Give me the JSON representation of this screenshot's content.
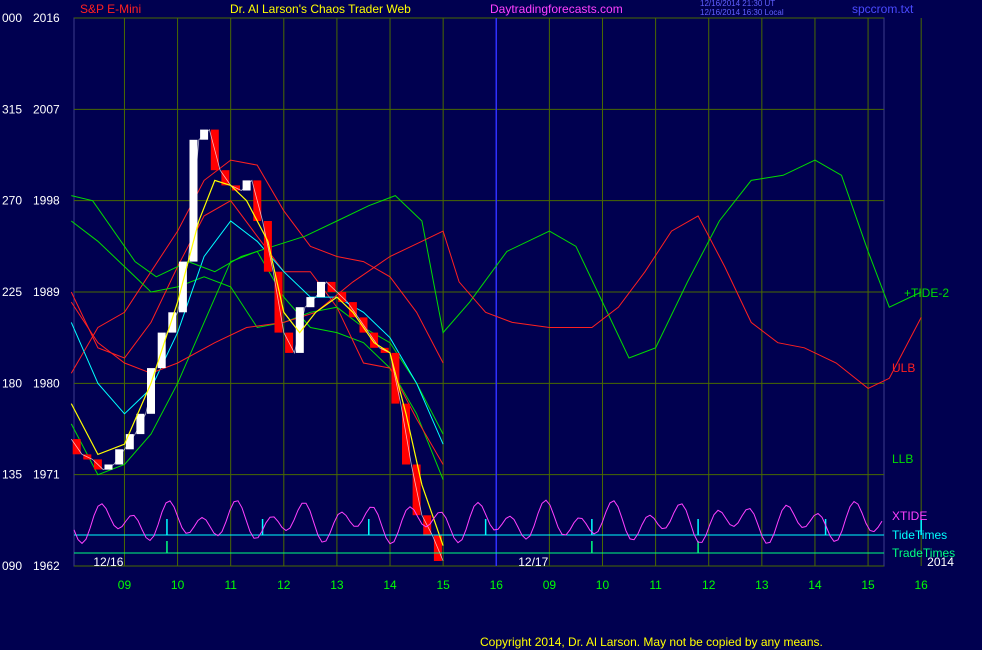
{
  "header": {
    "left_title": "S&P E-Mini",
    "center_title": "Dr. Al Larson's Chaos Trader Web",
    "site": "Daytradingforecasts.com",
    "timestamp_1": "12/16/2014 21:30 UT",
    "timestamp_2": "12/16/2014 16:30 Local",
    "file": "spccrom.txt"
  },
  "footer": {
    "copyright": "Copyright 2014, Dr. Al Larson. May not be copied by any means."
  },
  "colors": {
    "background": "#000050",
    "grid": "#4a6a00",
    "price_up": "#ffffff",
    "price_down": "#ff0000",
    "ema_fast": "#ffff00",
    "ema_mid": "#00ffff",
    "band_upper": "#ff2020",
    "band_lower": "#00dd00",
    "tide": "#00dd00",
    "ulb": "#ff2020",
    "xtide": "#ff40ff",
    "tide_times": "#00ffff",
    "trade_times": "#00ff80",
    "left_axis": "#ffffff",
    "price_axis": "#ffffff",
    "time_axis": "#00ff00"
  },
  "chart_data": {
    "type": "line",
    "price_axis": {
      "ticks": [
        "2016",
        "2007",
        "1998",
        "1989",
        "1980",
        "1971",
        "1962"
      ]
    },
    "left_axis": {
      "ticks": [
        "000",
        "315",
        "270",
        "225",
        "180",
        "135",
        "090"
      ]
    },
    "x_ticks": [
      "09",
      "10",
      "11",
      "12",
      "13",
      "14",
      "15",
      "16",
      "09",
      "10",
      "11",
      "12",
      "13",
      "14",
      "15",
      "16"
    ],
    "dates": [
      {
        "label": "12/16",
        "position": 0
      },
      {
        "label": "12/17",
        "position": 8
      },
      {
        "label": "2014",
        "position": 16
      }
    ],
    "right_labels": [
      {
        "text": "+TIDE-2",
        "color": "#00dd00"
      },
      {
        "text": "ULB",
        "color": "#ff2020"
      },
      {
        "text": "LLB",
        "color": "#00dd00"
      },
      {
        "text": "XTIDE",
        "color": "#ff40ff"
      },
      {
        "text": "TideTimes",
        "color": "#00ffff"
      },
      {
        "text": "TradeTimes",
        "color": "#00ff80"
      }
    ],
    "price_series": [
      [
        0.0,
        1974.5
      ],
      [
        0.2,
        1973.0
      ],
      [
        0.4,
        1972.5
      ],
      [
        0.6,
        1971.5
      ],
      [
        0.8,
        1972.0
      ],
      [
        1.0,
        1973.5
      ],
      [
        1.2,
        1975.0
      ],
      [
        1.4,
        1977.0
      ],
      [
        1.6,
        1981.5
      ],
      [
        1.8,
        1985.0
      ],
      [
        2.0,
        1987.0
      ],
      [
        2.2,
        1992.0
      ],
      [
        2.4,
        2004.0
      ],
      [
        2.6,
        2005.0
      ],
      [
        2.8,
        2001.0
      ],
      [
        3.0,
        1999.5
      ],
      [
        3.2,
        1999.0
      ],
      [
        3.4,
        2000.0
      ],
      [
        3.6,
        1996.0
      ],
      [
        3.8,
        1991.0
      ],
      [
        4.0,
        1985.0
      ],
      [
        4.2,
        1983.0
      ],
      [
        4.4,
        1987.5
      ],
      [
        4.6,
        1988.5
      ],
      [
        4.8,
        1990.0
      ],
      [
        5.0,
        1989.0
      ],
      [
        5.2,
        1988.0
      ],
      [
        5.4,
        1986.5
      ],
      [
        5.6,
        1985.0
      ],
      [
        5.8,
        1983.5
      ],
      [
        6.0,
        1983.0
      ],
      [
        6.2,
        1978.0
      ],
      [
        6.4,
        1972.0
      ],
      [
        6.6,
        1967.0
      ],
      [
        6.8,
        1965.0
      ],
      [
        7.0,
        1962.5
      ]
    ],
    "ema_fast": [
      [
        0.0,
        1978.0
      ],
      [
        0.5,
        1973.0
      ],
      [
        1.0,
        1974.0
      ],
      [
        1.5,
        1980.0
      ],
      [
        2.0,
        1988.0
      ],
      [
        2.4,
        1996.0
      ],
      [
        2.7,
        2000.0
      ],
      [
        3.0,
        1999.5
      ],
      [
        3.3,
        1998.0
      ],
      [
        3.7,
        1994.0
      ],
      [
        4.0,
        1987.0
      ],
      [
        4.3,
        1985.0
      ],
      [
        4.6,
        1987.0
      ],
      [
        5.0,
        1988.5
      ],
      [
        5.3,
        1987.0
      ],
      [
        5.7,
        1984.0
      ],
      [
        6.0,
        1983.0
      ],
      [
        6.3,
        1977.0
      ],
      [
        6.6,
        1970.0
      ],
      [
        7.0,
        1964.0
      ]
    ],
    "ema_mid": [
      [
        0.0,
        1986.0
      ],
      [
        0.5,
        1980.0
      ],
      [
        1.0,
        1977.0
      ],
      [
        1.5,
        1979.5
      ],
      [
        2.0,
        1985.0
      ],
      [
        2.5,
        1992.5
      ],
      [
        3.0,
        1996.0
      ],
      [
        3.5,
        1994.0
      ],
      [
        4.0,
        1991.0
      ],
      [
        4.5,
        1988.5
      ],
      [
        5.0,
        1988.5
      ],
      [
        5.5,
        1987.0
      ],
      [
        6.0,
        1984.5
      ],
      [
        6.5,
        1980.0
      ],
      [
        7.0,
        1974.0
      ]
    ],
    "upper_band": [
      [
        0.0,
        1981.0
      ],
      [
        0.5,
        1985.5
      ],
      [
        1.0,
        1987.0
      ],
      [
        1.5,
        1991.0
      ],
      [
        2.0,
        1995.0
      ],
      [
        2.5,
        2000.0
      ],
      [
        3.0,
        2002.0
      ],
      [
        3.5,
        2001.5
      ],
      [
        4.0,
        1997.0
      ],
      [
        4.5,
        1993.5
      ],
      [
        5.0,
        1992.5
      ],
      [
        5.5,
        1992.0
      ],
      [
        6.0,
        1990.5
      ],
      [
        6.5,
        1987.0
      ],
      [
        7.0,
        1982.0
      ]
    ],
    "lower_band": [
      [
        0.0,
        1976.0
      ],
      [
        0.5,
        1971.0
      ],
      [
        1.0,
        1972.0
      ],
      [
        1.5,
        1975.0
      ],
      [
        2.0,
        1980.0
      ],
      [
        2.5,
        1986.0
      ],
      [
        3.0,
        1992.0
      ],
      [
        3.5,
        1993.0
      ],
      [
        4.0,
        1988.5
      ],
      [
        4.5,
        1985.5
      ],
      [
        5.0,
        1985.0
      ],
      [
        5.5,
        1984.0
      ],
      [
        6.0,
        1981.5
      ],
      [
        6.5,
        1977.0
      ],
      [
        7.0,
        1970.5
      ]
    ],
    "upper_inner_band": [
      [
        0.0,
        1989.0
      ],
      [
        0.5,
        1983.5
      ],
      [
        1.0,
        1982.5
      ],
      [
        1.5,
        1986.0
      ],
      [
        2.0,
        1991.5
      ],
      [
        2.5,
        1996.5
      ],
      [
        3.0,
        1998.0
      ],
      [
        3.5,
        1994.5
      ],
      [
        4.0,
        1991.0
      ],
      [
        4.5,
        1991.0
      ],
      [
        5.0,
        1987.5
      ],
      [
        5.5,
        1982.0
      ],
      [
        6.0,
        1981.5
      ],
      [
        6.5,
        1976.5
      ],
      [
        7.0,
        1972.0
      ]
    ],
    "lower_inner_band": [
      [
        0.0,
        1996.0
      ],
      [
        0.5,
        1994.0
      ],
      [
        1.0,
        1991.5
      ],
      [
        1.5,
        1989.0
      ],
      [
        2.0,
        1989.5
      ],
      [
        2.5,
        1990.5
      ],
      [
        3.0,
        1989.5
      ],
      [
        3.5,
        1985.5
      ],
      [
        4.0,
        1986.0
      ],
      [
        4.5,
        1987.0
      ],
      [
        5.0,
        1987.5
      ],
      [
        5.5,
        1985.5
      ],
      [
        6.0,
        1984.0
      ],
      [
        6.5,
        1980.0
      ],
      [
        7.0,
        1975.0
      ]
    ],
    "tide": [
      [
        0.0,
        1998.5
      ],
      [
        0.4,
        1998.0
      ],
      [
        1.2,
        1992.0
      ],
      [
        1.6,
        1990.5
      ],
      [
        2.2,
        1992.0
      ],
      [
        2.7,
        1991.0
      ],
      [
        3.2,
        1992.5
      ],
      [
        3.8,
        1993.5
      ],
      [
        4.4,
        1994.5
      ],
      [
        5.0,
        1996.0
      ],
      [
        5.6,
        1997.5
      ],
      [
        6.1,
        1998.5
      ],
      [
        6.6,
        1996.0
      ],
      [
        7.0,
        1985.0
      ],
      [
        7.5,
        1988.0
      ],
      [
        8.2,
        1993.0
      ],
      [
        9.0,
        1995.0
      ],
      [
        9.5,
        1993.5
      ],
      [
        10.0,
        1988.0
      ],
      [
        10.5,
        1982.5
      ],
      [
        11.0,
        1983.5
      ],
      [
        11.6,
        1990.0
      ],
      [
        12.2,
        1996.0
      ],
      [
        12.8,
        2000.0
      ],
      [
        13.4,
        2000.5
      ],
      [
        14.0,
        2002.0
      ],
      [
        14.5,
        2000.5
      ],
      [
        15.0,
        1993.0
      ],
      [
        15.4,
        1987.5
      ],
      [
        16.0,
        1989.0
      ]
    ],
    "ulb": [
      [
        0.0,
        1988.0
      ],
      [
        0.5,
        1984.0
      ],
      [
        1.0,
        1982.0
      ],
      [
        1.5,
        1981.0
      ],
      [
        2.0,
        1982.0
      ],
      [
        2.7,
        1984.0
      ],
      [
        3.3,
        1985.5
      ],
      [
        4.0,
        1986.0
      ],
      [
        4.6,
        1987.0
      ],
      [
        5.3,
        1990.0
      ],
      [
        6.0,
        1992.5
      ],
      [
        6.6,
        1994.0
      ],
      [
        7.0,
        1995.0
      ],
      [
        7.3,
        1990.0
      ],
      [
        7.8,
        1987.0
      ],
      [
        8.3,
        1986.0
      ],
      [
        9.0,
        1985.5
      ],
      [
        9.8,
        1985.5
      ],
      [
        10.3,
        1987.5
      ],
      [
        10.8,
        1991.0
      ],
      [
        11.3,
        1995.0
      ],
      [
        11.8,
        1996.5
      ],
      [
        12.3,
        1991.5
      ],
      [
        12.8,
        1986.0
      ],
      [
        13.3,
        1984.0
      ],
      [
        13.8,
        1983.5
      ],
      [
        14.4,
        1982.0
      ],
      [
        15.0,
        1979.5
      ],
      [
        15.4,
        1980.5
      ],
      [
        16.0,
        1986.5
      ]
    ],
    "xtide_times": [
      1.8,
      3.6,
      5.6,
      7.8,
      9.8,
      11.8,
      14.2,
      16.0
    ],
    "trade_times": [
      1.8,
      9.8,
      11.8
    ]
  }
}
